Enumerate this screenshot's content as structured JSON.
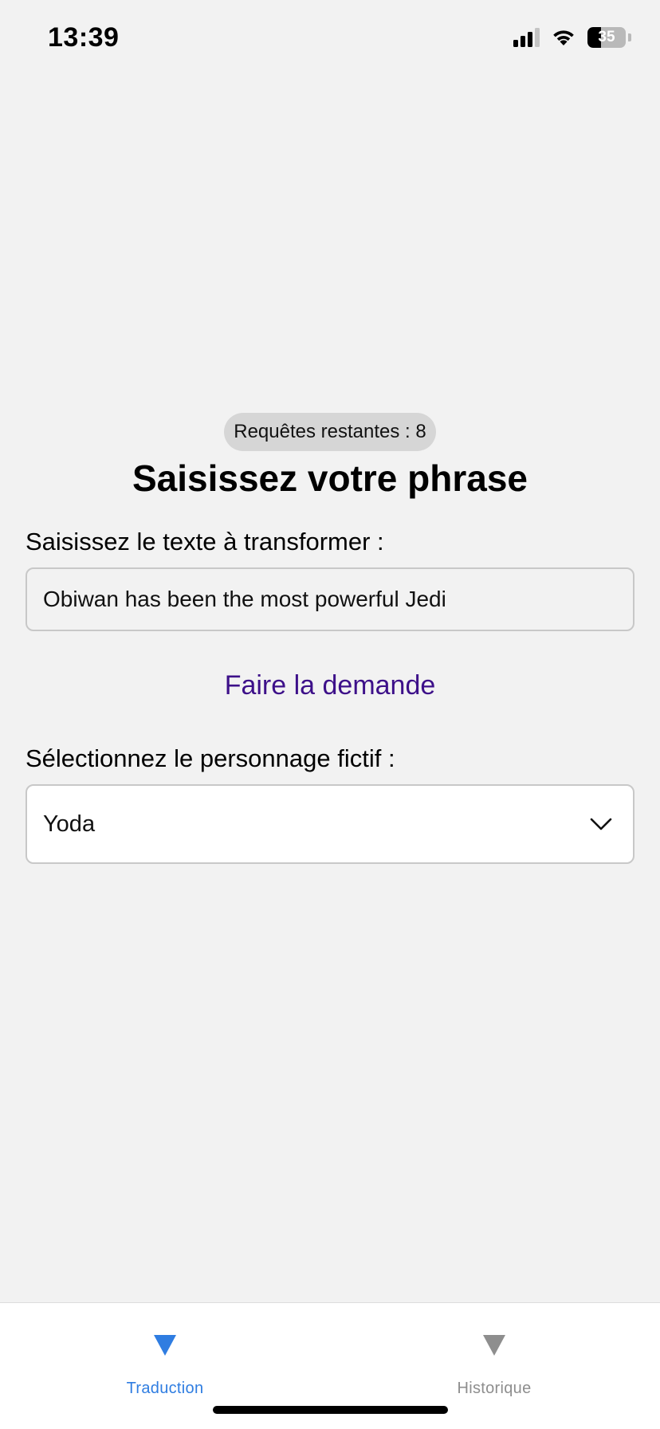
{
  "status_bar": {
    "time": "13:39",
    "battery_level": "35",
    "battery_fraction": 0.35,
    "signal_bars_active": 3,
    "signal_bars_total": 4,
    "icons": [
      "signal-icon",
      "wifi-icon",
      "battery-icon"
    ]
  },
  "main": {
    "requests_badge": "Requêtes restantes : 8",
    "title": "Saisissez votre phrase",
    "input_label": "Saisissez le texte à transformer :",
    "input_value": "Obiwan has been the most powerful Jedi",
    "submit_label": "Faire la demande",
    "select_label": "Sélectionnez le personnage fictif :",
    "select_value": "Yoda",
    "select_icon": "chevron-down-icon"
  },
  "tab_bar": {
    "tabs": [
      {
        "label": "Traduction",
        "active": true,
        "icon": "triangle-down-icon"
      },
      {
        "label": "Historique",
        "active": false,
        "icon": "triangle-down-icon"
      }
    ]
  },
  "colors": {
    "background": "#f2f2f2",
    "accent_link": "#3d1089",
    "tab_active": "#2f7de1",
    "tab_inactive": "#8e8e8e",
    "badge_bg": "#d6d6d6"
  }
}
